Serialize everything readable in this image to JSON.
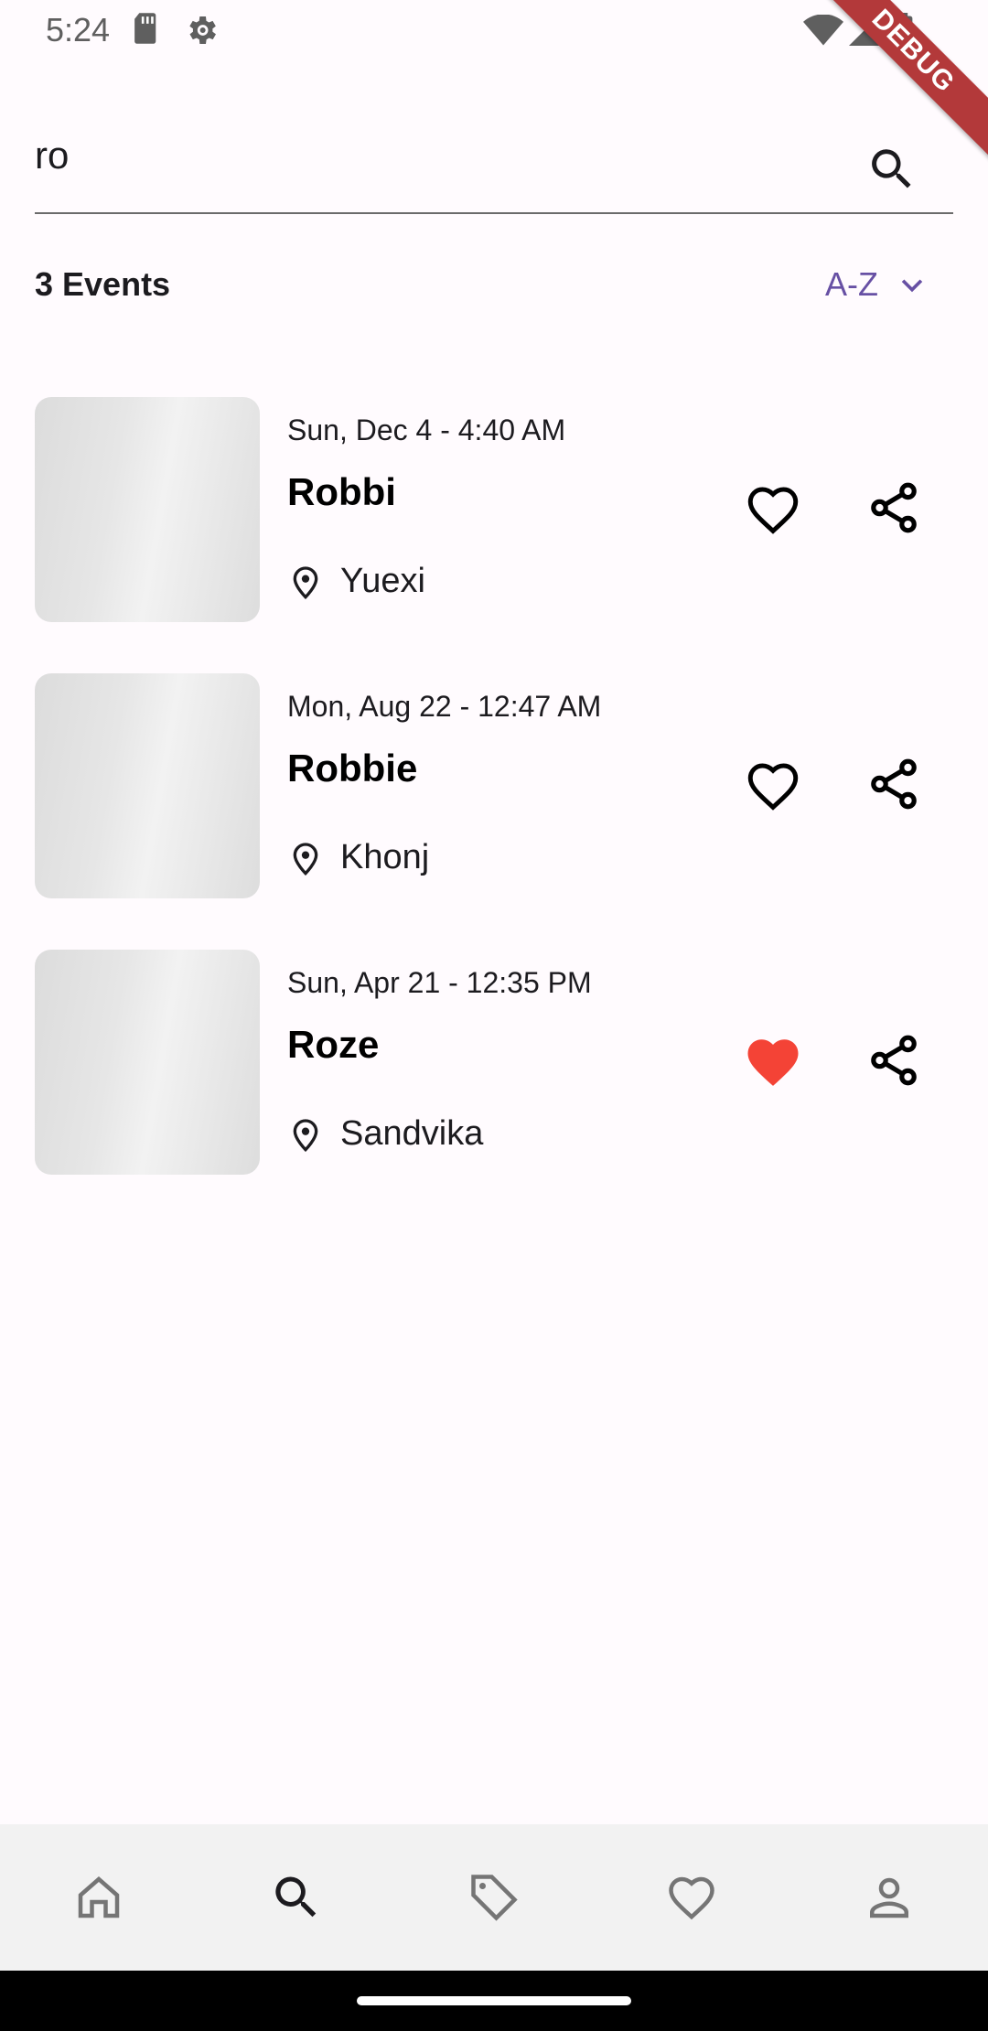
{
  "status_bar": {
    "time": "5:24",
    "icons_left": [
      "sd-card-icon",
      "settings-icon"
    ],
    "icons_right": [
      "wifi-icon",
      "signal-icon",
      "battery-icon"
    ]
  },
  "debug_banner": "DEBUG",
  "search": {
    "query": "ro",
    "icon": "search-icon"
  },
  "results": {
    "count_label": "3 Events",
    "sort_label": "A-Z",
    "sort_icon": "chevron-down-icon"
  },
  "events": [
    {
      "date": "Sun, Dec 4 - 4:40 AM",
      "title": "Robbi",
      "location": "Yuexi",
      "favorited": false
    },
    {
      "date": "Mon, Aug 22 - 12:47 AM",
      "title": "Robbie",
      "location": "Khonj",
      "favorited": false
    },
    {
      "date": "Sun, Apr 21 - 12:35 PM",
      "title": "Roze",
      "location": "Sandvika",
      "favorited": true
    }
  ],
  "bottom_nav": {
    "items": [
      "home-icon",
      "search-icon",
      "tag-icon",
      "heart-icon",
      "person-icon"
    ],
    "active": "search-icon"
  },
  "colors": {
    "accent": "#6750a4",
    "favorite": "#f44336",
    "background": "#fffbfe",
    "nav_background": "#f2f2f2"
  }
}
